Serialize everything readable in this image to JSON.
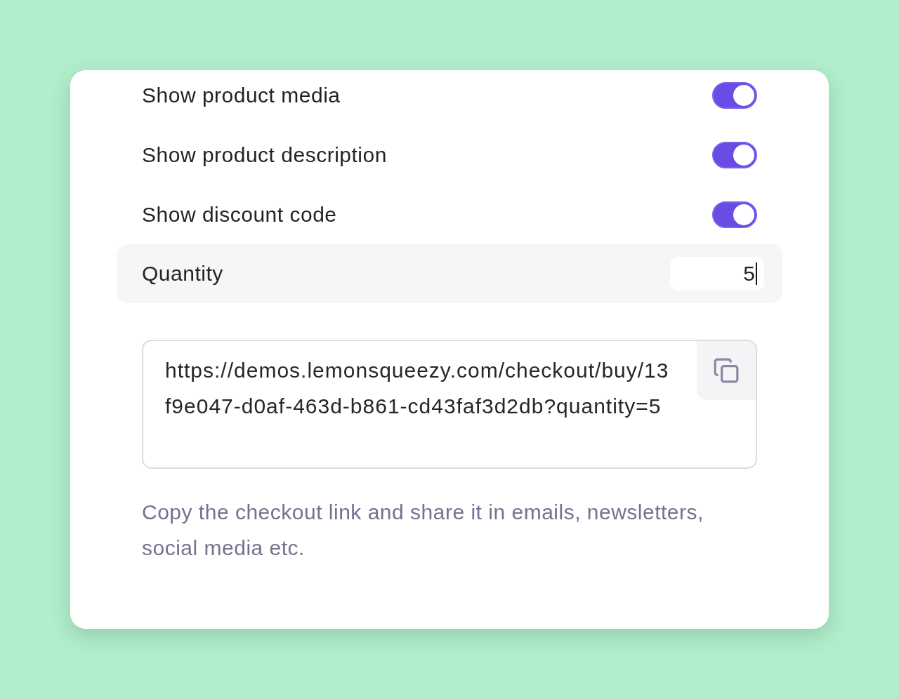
{
  "settings": [
    {
      "label": "Show product media",
      "on": true
    },
    {
      "label": "Show product description",
      "on": true
    },
    {
      "label": "Show discount code",
      "on": true
    }
  ],
  "quantity": {
    "label": "Quantity",
    "value": "5",
    "focused": true
  },
  "checkout_link": {
    "url": "https://demos.lemonsqueezy.com/checkout/buy/13f9e047-d0af-463d-b861-cd43faf3d2db?quantity=5"
  },
  "help_text": "Copy the checkout link and share it in emails, newsletters, social media etc."
}
